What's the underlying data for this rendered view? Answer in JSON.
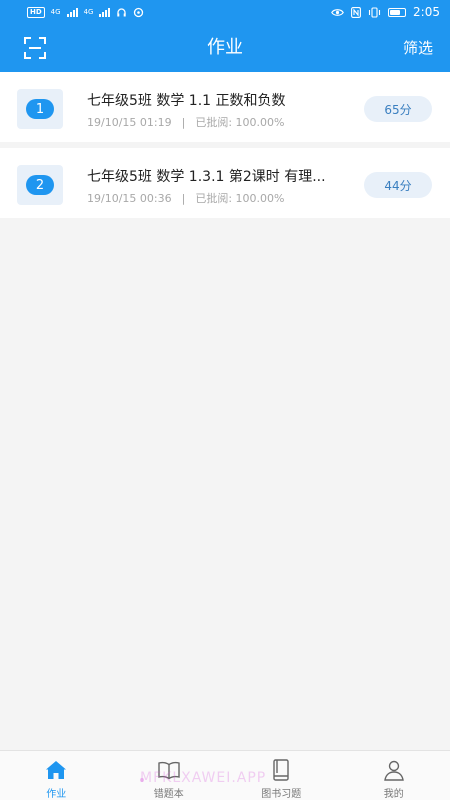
{
  "status_bar": {
    "hd_badge": "HD",
    "network_1": "4G",
    "network_2": "4G",
    "time": "2:05",
    "battery_level": 0.7
  },
  "header": {
    "title": "作业",
    "filter_label": "筛选"
  },
  "homework": [
    {
      "index": "1",
      "title": "七年级5班 数学 1.1  正数和负数",
      "date": "19/10/15 01:19",
      "separator": "|",
      "review": "已批阅:  100.00%",
      "score": "65分"
    },
    {
      "index": "2",
      "title": "七年级5班 数学 1.3.1  第2课时  有理...",
      "date": "19/10/15 00:36",
      "separator": "|",
      "review": "已批阅:  100.00%",
      "score": "44分"
    }
  ],
  "tabs": [
    {
      "label": "作业",
      "icon": "home-icon",
      "active": true
    },
    {
      "label": "错题本",
      "icon": "notebook-icon",
      "active": false
    },
    {
      "label": "图书习题",
      "icon": "book-icon",
      "active": false
    },
    {
      "label": "我的",
      "icon": "person-icon",
      "active": false
    }
  ],
  "watermark": "MFKLXAWEI.APP",
  "colors": {
    "primary": "#1f96f0",
    "pill_bg": "#e8f0f9",
    "pill_text": "#3a7fc0",
    "background": "#f4f4f4"
  }
}
